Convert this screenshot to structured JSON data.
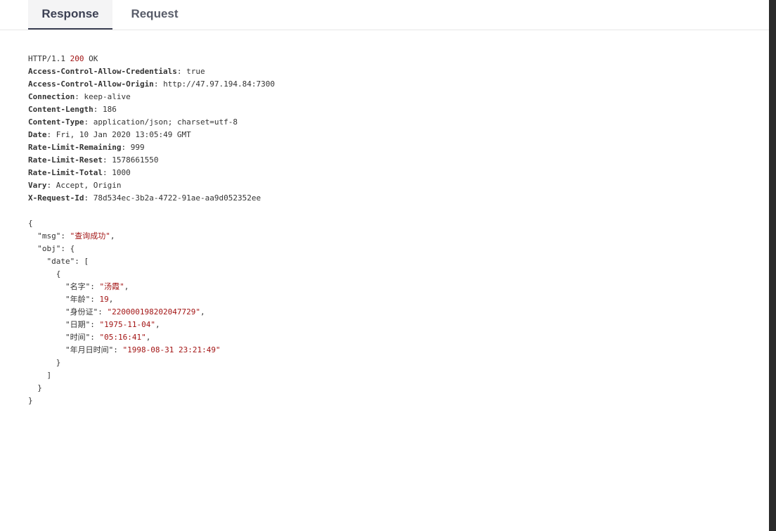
{
  "tabs": {
    "response": "Response",
    "request": "Request"
  },
  "status": {
    "protocol": "HTTP/1.1",
    "code": "200",
    "text": "OK"
  },
  "headers": [
    {
      "name": "Access-Control-Allow-Credentials",
      "value": "true"
    },
    {
      "name": "Access-Control-Allow-Origin",
      "value": "http://47.97.194.84:7300"
    },
    {
      "name": "Connection",
      "value": "keep-alive"
    },
    {
      "name": "Content-Length",
      "value": "186"
    },
    {
      "name": "Content-Type",
      "value": "application/json; charset=utf-8"
    },
    {
      "name": "Date",
      "value": "Fri, 10 Jan 2020 13:05:49 GMT"
    },
    {
      "name": "Rate-Limit-Remaining",
      "value": "999"
    },
    {
      "name": "Rate-Limit-Reset",
      "value": "1578661550"
    },
    {
      "name": "Rate-Limit-Total",
      "value": "1000"
    },
    {
      "name": "Vary",
      "value": "Accept, Origin"
    },
    {
      "name": "X-Request-Id",
      "value": "78d534ec-3b2a-4722-91ae-aa9d052352ee"
    }
  ],
  "body": {
    "msg_key": "\"msg\"",
    "msg_value": "\"查询成功\"",
    "obj_key": "\"obj\"",
    "date_key": "\"date\"",
    "fields": [
      {
        "key": "\"名字\"",
        "value": "\"汤霞\"",
        "type": "string"
      },
      {
        "key": "\"年龄\"",
        "value": "19",
        "type": "number"
      },
      {
        "key": "\"身份证\"",
        "value": "\"220000198202047729\"",
        "type": "string"
      },
      {
        "key": "\"日期\"",
        "value": "\"1975-11-04\"",
        "type": "string"
      },
      {
        "key": "\"时间\"",
        "value": "\"05:16:41\"",
        "type": "string"
      },
      {
        "key": "\"年月日时间\"",
        "value": "\"1998-08-31 23:21:49\"",
        "type": "string"
      }
    ]
  }
}
